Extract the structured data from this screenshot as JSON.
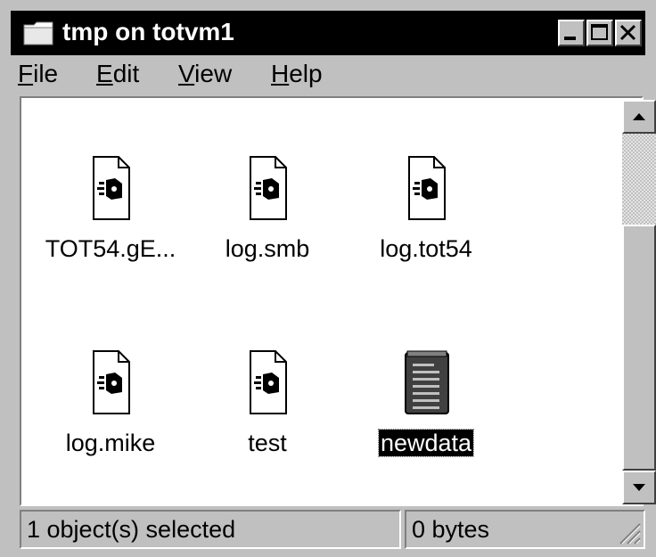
{
  "window": {
    "title": "tmp on totvm1"
  },
  "menu": {
    "file": "File",
    "edit": "Edit",
    "view": "View",
    "help": "Help",
    "file_key": "F",
    "file_rest": "ile",
    "edit_key": "E",
    "edit_rest": "dit",
    "view_key": "V",
    "view_rest": "iew",
    "help_key": "H",
    "help_rest": "elp"
  },
  "files": [
    {
      "name": "TOT54.gE...",
      "icon": "file-icon"
    },
    {
      "name": "log.smb",
      "icon": "file-icon"
    },
    {
      "name": "log.tot54",
      "icon": "file-icon"
    },
    {
      "name": "log.mike",
      "icon": "file-icon"
    },
    {
      "name": "test",
      "icon": "file-icon"
    },
    {
      "name": "newdata",
      "icon": "notepad-icon",
      "selected": true
    }
  ],
  "status": {
    "selection": "1 object(s) selected",
    "size": "0 bytes"
  },
  "colors": {
    "titlebar": "#000000",
    "face": "#c0c0c0",
    "selection": "#000000"
  }
}
